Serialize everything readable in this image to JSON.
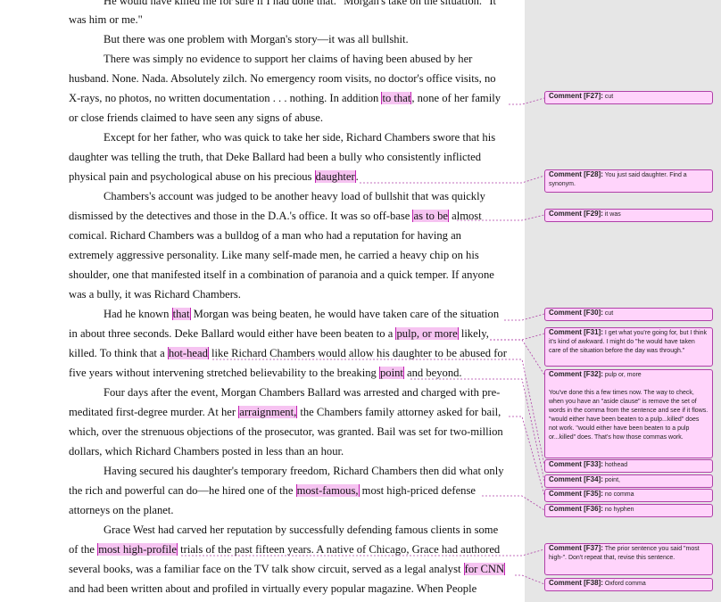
{
  "document": {
    "lines": [
      {
        "text": "He would have killed me for sure if I had done that.\" Morgan's take on the situation. \"It",
        "indent": true
      },
      {
        "text": "was him or me.\"",
        "indent": false
      },
      {
        "text": "But there was one problem with Morgan's story—it was all bullshit.",
        "indent": true
      },
      {
        "text": "There was simply no evidence to support her claims of having been abused by her",
        "indent": true
      },
      {
        "text": "husband. None. Nada. Absolutely zilch. No emergency room visits, no doctor's office visits, no",
        "indent": false
      },
      {
        "text": "X-rays, no photos, no written documentation  . . . nothing. In addition to that, none of her family",
        "indent": false
      },
      {
        "text": "or close friends claimed to have seen any signs of abuse.",
        "indent": false
      },
      {
        "text": "Except for her father, who was quick to take her side, Richard Chambers swore that his",
        "indent": true
      },
      {
        "text": "daughter was telling the truth, that Deke Ballard had been a bully who consistently inflicted",
        "indent": false
      },
      {
        "text": "physical pain and psychological abuse on his precious daughter.",
        "indent": false
      },
      {
        "text": "Chambers's account was judged to be another heavy load of bullshit that was quickly",
        "indent": true
      },
      {
        "text": "dismissed by the detectives and those in the D.A.'s office. It was so off-base as to be almost",
        "indent": false
      },
      {
        "text": "comical.  Richard Chambers was a bulldog of a man who had a reputation for having an",
        "indent": false
      },
      {
        "text": "extremely aggressive personality. Like many self-made men, he carried a heavy chip on his",
        "indent": false
      },
      {
        "text": "shoulder, one that manifested itself in a combination of paranoia and a quick temper.  If anyone",
        "indent": false
      },
      {
        "text": "was a bully, it was Richard Chambers.",
        "indent": false
      },
      {
        "text": "Had he known that Morgan was being beaten, he would have taken care of the situation",
        "indent": true
      },
      {
        "text": "in about three seconds. Deke Ballard would either have been beaten to a pulp, or more likely,",
        "indent": false
      },
      {
        "text": "killed. To think that a hot-head like Richard Chambers would allow his daughter to be abused for",
        "indent": false
      },
      {
        "text": "five years without intervening stretched believability to the breaking point and beyond.",
        "indent": false
      },
      {
        "text": "Four days after the event, Morgan Chambers Ballard was arrested and charged with pre-",
        "indent": true
      },
      {
        "text": "meditated first-degree murder. At her arraignment, the Chambers family attorney asked for bail,",
        "indent": false
      },
      {
        "text": "which, over the strenuous objections of the prosecutor, was granted. Bail was set for two-million",
        "indent": false
      },
      {
        "text": "dollars, which Richard Chambers posted in less than an hour.",
        "indent": false
      },
      {
        "text": "Having secured his daughter's temporary freedom, Richard Chambers then did what only",
        "indent": true
      },
      {
        "text": "the rich and powerful can do—he hired one of the most-famous, most high-priced defense",
        "indent": false
      },
      {
        "text": "attorneys on the planet.",
        "indent": false
      },
      {
        "text": "Grace West had carved her reputation by successfully defending famous clients in some",
        "indent": true
      },
      {
        "text": "of the most high-profile trials of the past fifteen years. A native of Chicago, Grace had authored",
        "indent": false
      },
      {
        "text": "several books, was a familiar face on the TV talk show circuit, served as a legal analyst for CNN",
        "indent": false
      },
      {
        "text": "and had been written about and profiled in virtually every popular magazine. When People",
        "indent": false
      }
    ]
  },
  "comments": [
    {
      "tag": "Comment [F27]:",
      "text": "cut"
    },
    {
      "tag": "Comment [F28]:",
      "text": "You just said daughter.  Find a synonym."
    },
    {
      "tag": "Comment [F29]:",
      "text": "it was"
    },
    {
      "tag": "Comment [F30]:",
      "text": "cut"
    },
    {
      "tag": "Comment [F31]:",
      "text": "I get what you're going for, but I think it's kind of awkward.  I might do \"he would have taken care of the situation before the day was through.\""
    },
    {
      "tag": "Comment [F32]:",
      "text": "pulp or, more",
      "extra": "You've done this a few times now.  The way to check, when you have an \"aside clause\" is remove the set of words in the comma from the sentence and see if it flows.  \"would either have been beaten to a pulp...killed\" does not work.  \"would either have been beaten to a pulp or...killed\" does.  That's how those commas work."
    },
    {
      "tag": "Comment [F33]:",
      "text": "hothead"
    },
    {
      "tag": "Comment [F34]:",
      "text": "point,"
    },
    {
      "tag": "Comment [F35]:",
      "text": "no comma"
    },
    {
      "tag": "Comment [F36]:",
      "text": "no hyphen"
    },
    {
      "tag": "Comment [F37]:",
      "text": "The prior sentence you said \"most high-\". Don't repeat that, revise this sentence."
    },
    {
      "tag": "Comment [F38]:",
      "text": "Oxford comma"
    }
  ],
  "colors": {
    "highlight": "#f6c3f1",
    "comment_bg": "#ffd4fb",
    "comment_border": "#b040a8",
    "pane": "#e6e6e6"
  }
}
